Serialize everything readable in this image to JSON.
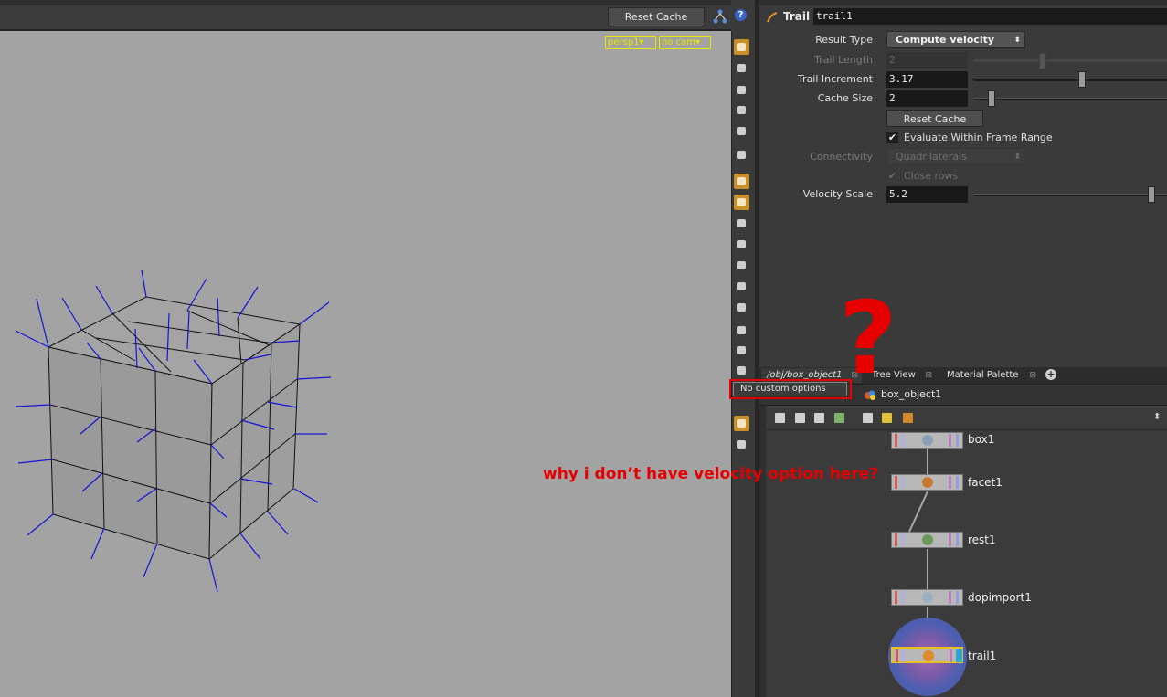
{
  "viewport": {
    "reset_cache_label": "Reset Cache",
    "help_label": "?",
    "persp_label": "persp1",
    "cam_label": "no cam"
  },
  "toolbar_icons": [
    "layers-icon",
    "display-icon",
    "light-icon",
    "cape-icon",
    "sphere-icon",
    "eye-visibility-icon",
    "snap-point-icon",
    "snap-grid-icon",
    "camera-icon",
    "paint-icon",
    "stamp-icon",
    "curve-icon",
    "box-icon",
    "tool-arrows-icon",
    "lock-icon",
    "comment-icon",
    "four-views-icon",
    "preview-eye-icon"
  ],
  "params": {
    "node_type": "Trail",
    "node_name": "trail1",
    "result_type_label": "Result Type",
    "result_type_value": "Compute velocity",
    "trail_length_label": "Trail Length",
    "trail_length_value": "2",
    "trail_increment_label": "Trail Increment",
    "trail_increment_value": "3.17",
    "cache_size_label": "Cache Size",
    "cache_size_value": "2",
    "reset_cache_label": "Reset Cache",
    "evaluate_label": "Evaluate Within Frame Range",
    "connectivity_label": "Connectivity",
    "connectivity_value": "Quadrilaterals",
    "close_rows_label": "Close rows",
    "velocity_scale_label": "Velocity Scale",
    "velocity_scale_value": "5.2"
  },
  "tabs": {
    "tab1": "/obj/box_object1",
    "tab2": "Tree View",
    "tab3": "Material Palette"
  },
  "network": {
    "path": "box_object1",
    "nodes": [
      "box1",
      "facet1",
      "rest1",
      "dopimport1",
      "trail1"
    ]
  },
  "annotations": {
    "tooltip": "No custom options",
    "question_mark": "?",
    "question": "why i don’t have velocity option here?"
  },
  "colors": {
    "annotation_red": "#e60000",
    "viewport_bg": "#a3a3a3",
    "normals_blue": "#1414d8",
    "active_tool": "#c8902a"
  }
}
